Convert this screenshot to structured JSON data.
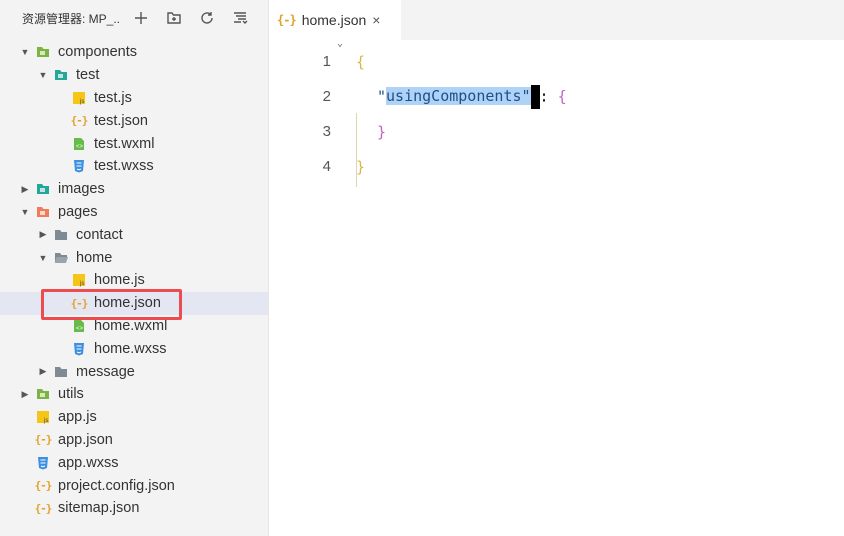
{
  "sidebar": {
    "title": "资源管理器: MP_...",
    "items": [
      {
        "label": "components",
        "depth": 0,
        "kind": "folder-special",
        "arrow": "down",
        "color": "#7cb342"
      },
      {
        "label": "test",
        "depth": 1,
        "kind": "folder-special",
        "arrow": "down",
        "color": "#26a69a"
      },
      {
        "label": "test.js",
        "depth": 2,
        "kind": "js"
      },
      {
        "label": "test.json",
        "depth": 2,
        "kind": "json"
      },
      {
        "label": "test.wxml",
        "depth": 2,
        "kind": "wxml"
      },
      {
        "label": "test.wxss",
        "depth": 2,
        "kind": "wxss"
      },
      {
        "label": "images",
        "depth": 0,
        "kind": "folder-special",
        "arrow": "right",
        "color": "#26a69a"
      },
      {
        "label": "pages",
        "depth": 0,
        "kind": "folder-special",
        "arrow": "down",
        "color": "#ef7d5a"
      },
      {
        "label": "contact",
        "depth": 1,
        "kind": "folder",
        "arrow": "right"
      },
      {
        "label": "home",
        "depth": 1,
        "kind": "folder-open",
        "arrow": "down"
      },
      {
        "label": "home.js",
        "depth": 2,
        "kind": "js"
      },
      {
        "label": "home.json",
        "depth": 2,
        "kind": "json",
        "selected": true
      },
      {
        "label": "home.wxml",
        "depth": 2,
        "kind": "wxml"
      },
      {
        "label": "home.wxss",
        "depth": 2,
        "kind": "wxss"
      },
      {
        "label": "message",
        "depth": 1,
        "kind": "folder",
        "arrow": "right"
      },
      {
        "label": "utils",
        "depth": 0,
        "kind": "folder-special",
        "arrow": "right",
        "color": "#7cb342"
      },
      {
        "label": "app.js",
        "depth": 0,
        "kind": "js"
      },
      {
        "label": "app.json",
        "depth": 0,
        "kind": "json"
      },
      {
        "label": "app.wxss",
        "depth": 0,
        "kind": "wxss"
      },
      {
        "label": "project.config.json",
        "depth": 0,
        "kind": "json"
      },
      {
        "label": "sitemap.json",
        "depth": 0,
        "kind": "json"
      }
    ]
  },
  "editor": {
    "tab": {
      "icon": "{-}",
      "label": "home.json",
      "close": "×"
    },
    "lines": [
      {
        "num": "1",
        "open": "{"
      },
      {
        "num": "2",
        "q1": "\"",
        "key_sel": "usingComponents",
        "q2": "\"",
        "rest": ": ",
        "brace": "{"
      },
      {
        "num": "3",
        "close": "}"
      },
      {
        "num": "4",
        "close": "}"
      }
    ]
  },
  "colors": {
    "accent_box": "#ee4b51",
    "selection": "#aed3f7"
  }
}
